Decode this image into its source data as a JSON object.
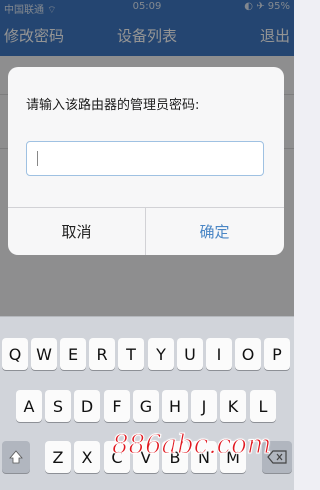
{
  "status_bar": {
    "carrier": "中国联通 ⌔",
    "time": "05:09",
    "battery": "◐ ✈ 95%"
  },
  "nav_bar": {
    "left": "修改密码",
    "title": "设备列表",
    "right": "退出"
  },
  "dialog": {
    "message": "请输入该路由器的管理员密码:",
    "password_value": "",
    "cancel": "取消",
    "ok": "确定"
  },
  "keyboard": {
    "row1": [
      "Q",
      "W",
      "E",
      "R",
      "T",
      "Y",
      "U",
      "I",
      "O",
      "P"
    ],
    "row2": [
      "A",
      "S",
      "D",
      "F",
      "G",
      "H",
      "J",
      "K",
      "L"
    ],
    "row3": [
      "Z",
      "X",
      "C",
      "V",
      "B",
      "N",
      "M"
    ],
    "shift_icon": "shift-icon",
    "delete_icon": "delete-icon"
  },
  "watermark": "886abc.com",
  "colors": {
    "nav": "#3f78c3",
    "accent": "#4a86c5",
    "watermark": "#e01820"
  }
}
